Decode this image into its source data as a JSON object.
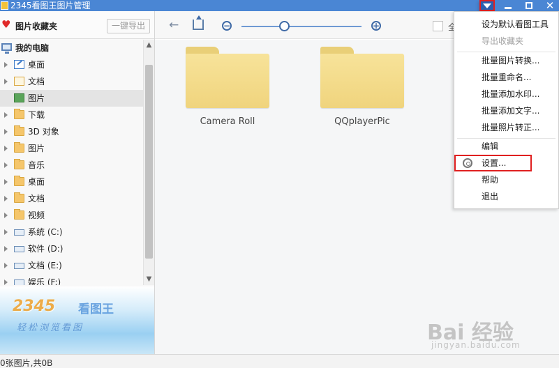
{
  "window": {
    "title": "2345看图王图片管理"
  },
  "favorites": {
    "title": "图片收藏夹",
    "export_label": "一键导出"
  },
  "tree": {
    "items": [
      {
        "label": "我的电脑",
        "icon": "computer-icon",
        "expandable": false,
        "bold": true
      },
      {
        "label": "桌面",
        "icon": "desktop-icon",
        "expandable": true
      },
      {
        "label": "文档",
        "icon": "document-folder-icon",
        "expandable": true
      },
      {
        "label": "图片",
        "icon": "picture-folder-icon",
        "expandable": false,
        "selected": true
      },
      {
        "label": "下载",
        "icon": "folder-icon",
        "expandable": true
      },
      {
        "label": "3D 对象",
        "icon": "folder-icon",
        "expandable": true
      },
      {
        "label": "图片",
        "icon": "folder-icon",
        "expandable": true
      },
      {
        "label": "音乐",
        "icon": "folder-icon",
        "expandable": true
      },
      {
        "label": "桌面",
        "icon": "folder-icon",
        "expandable": true
      },
      {
        "label": "文档",
        "icon": "folder-icon",
        "expandable": true
      },
      {
        "label": "视频",
        "icon": "folder-icon",
        "expandable": true
      },
      {
        "label": "系统 (C:)",
        "icon": "drive-icon",
        "expandable": true
      },
      {
        "label": "软件 (D:)",
        "icon": "drive-icon",
        "expandable": true
      },
      {
        "label": "文档 (E:)",
        "icon": "drive-icon",
        "expandable": true
      },
      {
        "label": "娱乐 (F:)",
        "icon": "drive-icon",
        "expandable": true
      }
    ]
  },
  "ad": {
    "brand": "2345",
    "brand_suffix": "看图王",
    "slogan": "轻松浏览看图"
  },
  "toolbar": {
    "zoom_level": 0.36,
    "checkbox_label": "全"
  },
  "folders": [
    {
      "name": "Camera Roll"
    },
    {
      "name": "QQplayerPic"
    }
  ],
  "statusbar": {
    "text": "0张图片,共0B"
  },
  "menu": {
    "items": [
      {
        "label": "设为默认看图工具",
        "enabled": true
      },
      {
        "label": "导出收藏夹",
        "enabled": false
      },
      {
        "label": "批量图片转换...",
        "enabled": true
      },
      {
        "label": "批量重命名...",
        "enabled": true
      },
      {
        "label": "批量添加水印...",
        "enabled": true
      },
      {
        "label": "批量添加文字...",
        "enabled": true
      },
      {
        "label": "批量照片转正...",
        "enabled": true
      },
      {
        "label": "编辑",
        "enabled": true
      },
      {
        "label": "设置...",
        "enabled": true,
        "highlighted": true,
        "icon": "gear-icon"
      },
      {
        "label": "帮助",
        "enabled": true
      },
      {
        "label": "退出",
        "enabled": true
      }
    ]
  },
  "watermark": {
    "main": "Bai 经验",
    "sub": "jingyan.baidu.com"
  },
  "colors": {
    "titlebar": "#4a86d4",
    "highlight_border": "#e02020",
    "folder": "#f0d47d"
  }
}
